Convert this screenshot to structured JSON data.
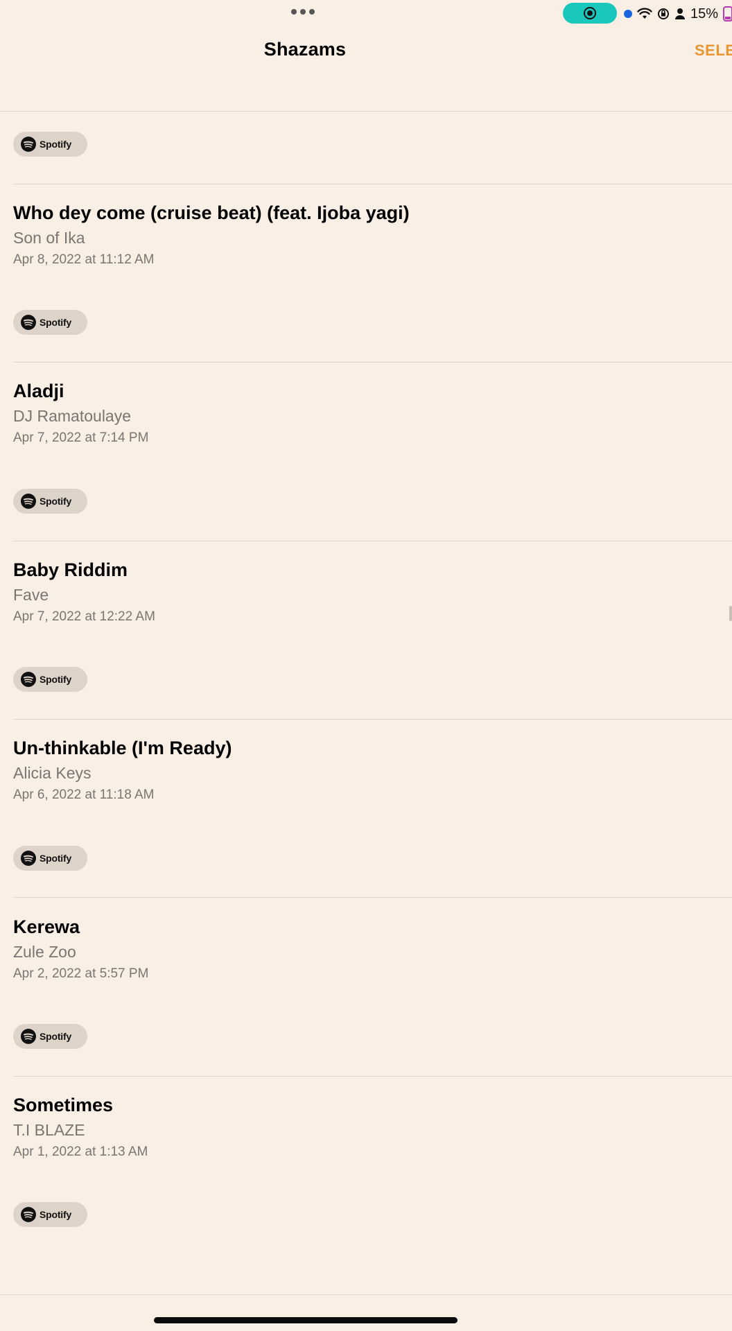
{
  "status_bar": {
    "dots_icon": "more-dots-icon",
    "record_icon": "screen-record-icon",
    "battery_percent": "15%",
    "icons": [
      "location-dot-icon",
      "wifi-icon",
      "orientation-lock-icon",
      "person-icon",
      "battery-icon"
    ]
  },
  "nav": {
    "title": "Shazams",
    "select_label": "SELE"
  },
  "spotify_label": "Spotify",
  "items": [
    {
      "title": "Who dey come (cruise beat) (feat. Ijoba yagi)",
      "artist": "Son of Ika",
      "date": "Apr 8, 2022 at 11:12 AM"
    },
    {
      "title": "Aladji",
      "artist": "DJ Ramatoulaye",
      "date": "Apr 7, 2022 at 7:14 PM"
    },
    {
      "title": "Baby Riddim",
      "artist": "Fave",
      "date": "Apr 7, 2022 at 12:22 AM"
    },
    {
      "title": "Un-thinkable (I'm Ready)",
      "artist": "Alicia Keys",
      "date": "Apr 6, 2022 at 11:18 AM"
    },
    {
      "title": "Kerewa",
      "artist": "Zule Zoo",
      "date": "Apr 2, 2022 at 5:57 PM"
    },
    {
      "title": "Sometimes",
      "artist": "T.I BLAZE",
      "date": "Apr 1, 2022 at 1:13 AM"
    }
  ],
  "colors": {
    "background": "#f9efe5",
    "accent": "#e8962f",
    "record_pill": "#19c7bd",
    "secondary_text": "#7b7570"
  }
}
